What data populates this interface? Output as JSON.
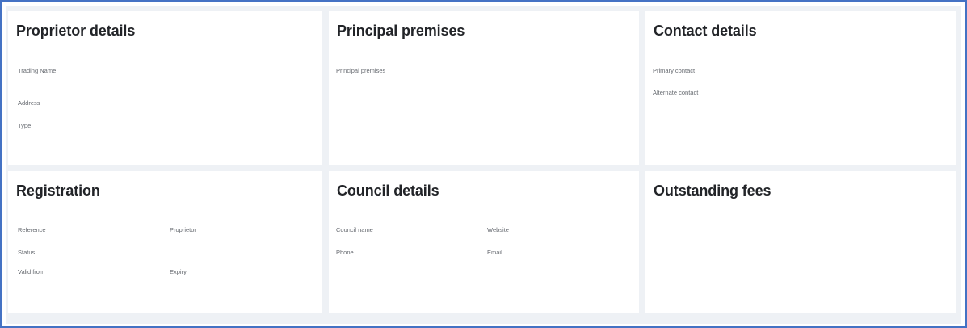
{
  "cards": {
    "proprietor": {
      "title": "Proprietor details",
      "fields": [
        "Trading Name",
        "Address",
        "Type"
      ]
    },
    "premises": {
      "title": "Principal premises",
      "fields": [
        "Principal premises"
      ]
    },
    "contact": {
      "title": "Contact details",
      "fields": [
        "Primary contact",
        "Alternate contact"
      ]
    },
    "registration": {
      "title": "Registration",
      "fields": [
        "Reference",
        "Proprietor",
        "Status",
        "Valid from",
        "Expiry"
      ]
    },
    "council": {
      "title": "Council details",
      "fields": [
        "Council name",
        "Website",
        "Phone",
        "Email"
      ]
    },
    "fees": {
      "title": "Outstanding fees",
      "fields": []
    }
  },
  "colors": {
    "frame_border": "#4472c4",
    "canvas_background": "#eef1f5",
    "card_background": "#ffffff",
    "title_text": "#222428",
    "label_text": "#666a70"
  }
}
